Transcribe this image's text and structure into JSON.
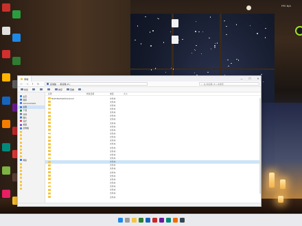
{
  "overlay": {
    "fps_text": "FPS N/A"
  },
  "desktop": {
    "left_icons": [
      {
        "label": "",
        "color": "#c9302c"
      },
      {
        "label": "",
        "color": "#2a9d3f"
      },
      {
        "label": "",
        "color": "#e0e0e0"
      },
      {
        "label": "",
        "color": "#1e88e5"
      },
      {
        "label": "",
        "color": "#d32f2f"
      },
      {
        "label": "",
        "color": "#2e7d32"
      },
      {
        "label": "",
        "color": "#ffb300"
      },
      {
        "label": "",
        "color": "#616161"
      },
      {
        "label": "",
        "color": "#1565c0"
      },
      {
        "label": "",
        "color": "#6a1b9a"
      },
      {
        "label": "",
        "color": "#f57c00"
      },
      {
        "label": "",
        "color": "#c62828"
      },
      {
        "label": "",
        "color": "#00897b"
      },
      {
        "label": "",
        "color": "#e53935"
      },
      {
        "label": "",
        "color": "#7cb342"
      },
      {
        "label": "",
        "color": "#5d4037"
      },
      {
        "label": "",
        "color": "#e91e63"
      },
      {
        "label": "",
        "color": "#fbc02d"
      }
    ],
    "file_icons": [
      {
        "label": "",
        "color": "#f2f2f2"
      },
      {
        "label": "",
        "color": "#f2f2f2"
      }
    ]
  },
  "explorer": {
    "tab_title": "本地",
    "window_controls": {
      "minimize": "—",
      "maximize": "☐",
      "close": "✕"
    },
    "address": {
      "parts": [
        "此电脑",
        "新加卷 (E:)"
      ],
      "search_placeholder": "在 新加卷 (E:) 中搜索"
    },
    "toolbar": [
      {
        "label": "新建"
      },
      {
        "label": ""
      },
      {
        "label": ""
      },
      {
        "label": ""
      },
      {
        "label": "排序"
      },
      {
        "label": "查看"
      },
      {
        "label": "···"
      }
    ],
    "nav_items": [
      {
        "label": "主页",
        "color": "#3d7bd9",
        "selected": false
      },
      {
        "label": "图库",
        "color": "#3d7bd9",
        "selected": false
      },
      {
        "label": "Administrator",
        "color": "#3d7bd9",
        "selected": false
      },
      {
        "label": "桌面",
        "color": "#3d7bd9",
        "selected": true
      },
      {
        "label": "下载",
        "color": "#2a8f4b",
        "selected": false
      },
      {
        "label": "文档",
        "color": "#6b7fa8",
        "selected": false
      },
      {
        "label": "图片",
        "color": "#3d7bd9",
        "selected": false
      },
      {
        "label": "音乐",
        "color": "#d9534f",
        "selected": false
      },
      {
        "label": "视频",
        "color": "#8a4fd9",
        "selected": false
      },
      {
        "label": "此电脑",
        "color": "#3d7bd9",
        "selected": false
      },
      {
        "label": "",
        "color": "#f5c542",
        "selected": false
      },
      {
        "label": "",
        "color": "#f5c542",
        "selected": false
      },
      {
        "label": "",
        "color": "#f5c542",
        "selected": false
      },
      {
        "label": "",
        "color": "#f5c542",
        "selected": false
      },
      {
        "label": "",
        "color": "#f5c542",
        "selected": false
      },
      {
        "label": "",
        "color": "#f5c542",
        "selected": false
      },
      {
        "label": "",
        "color": "#f5c542",
        "selected": false
      },
      {
        "label": "",
        "color": "#f5c542",
        "selected": false
      },
      {
        "label": "网络",
        "color": "#3d7bd9",
        "selected": false
      },
      {
        "label": "",
        "color": "#f5c542",
        "selected": false
      },
      {
        "label": "",
        "color": "#f5c542",
        "selected": false
      },
      {
        "label": "",
        "color": "#f5c542",
        "selected": false
      },
      {
        "label": "",
        "color": "#f5c542",
        "selected": false
      },
      {
        "label": "",
        "color": "#f5c542",
        "selected": false
      },
      {
        "label": "",
        "color": "#f5c542",
        "selected": false
      },
      {
        "label": "",
        "color": "#f5c542",
        "selected": false
      },
      {
        "label": "",
        "color": "#f5c542",
        "selected": false
      }
    ],
    "columns": [
      "名称",
      "修改日期",
      "类型",
      "大小"
    ],
    "files": [
      {
        "name": "BaiduNetdiskDownload",
        "date": "",
        "type": "文件夹",
        "selected": false
      },
      {
        "name": "",
        "date": "",
        "type": "文件夹",
        "selected": false
      },
      {
        "name": "",
        "date": "",
        "type": "文件夹",
        "selected": false
      },
      {
        "name": "",
        "date": "",
        "type": "文件夹",
        "selected": false
      },
      {
        "name": "",
        "date": "",
        "type": "文件夹",
        "selected": false
      },
      {
        "name": "",
        "date": "",
        "type": "文件夹",
        "selected": false
      },
      {
        "name": "",
        "date": "",
        "type": "文件夹",
        "selected": false
      },
      {
        "name": "",
        "date": "",
        "type": "文件夹",
        "selected": false
      },
      {
        "name": "",
        "date": "",
        "type": "文件夹",
        "selected": false
      },
      {
        "name": "",
        "date": "",
        "type": "文件夹",
        "selected": false
      },
      {
        "name": "",
        "date": "",
        "type": "文件夹",
        "selected": false
      },
      {
        "name": "",
        "date": "",
        "type": "文件夹",
        "selected": false
      },
      {
        "name": "",
        "date": "",
        "type": "文件夹",
        "selected": false
      },
      {
        "name": "",
        "date": "",
        "type": "文件夹",
        "selected": false
      },
      {
        "name": "",
        "date": "",
        "type": "文件夹",
        "selected": false
      },
      {
        "name": "",
        "date": "",
        "type": "文件夹",
        "selected": false
      },
      {
        "name": "",
        "date": "",
        "type": "文件夹",
        "selected": false
      },
      {
        "name": "",
        "date": "",
        "type": "文件夹",
        "selected": false
      },
      {
        "name": "",
        "date": "",
        "type": "文件夹",
        "selected": true
      },
      {
        "name": "",
        "date": "",
        "type": "文件夹",
        "selected": false
      },
      {
        "name": "",
        "date": "",
        "type": "文件夹",
        "selected": false
      },
      {
        "name": "",
        "date": "",
        "type": "文件夹",
        "selected": false
      },
      {
        "name": "",
        "date": "",
        "type": "文件夹",
        "selected": false
      },
      {
        "name": "",
        "date": "",
        "type": "文件夹",
        "selected": false
      },
      {
        "name": "",
        "date": "",
        "type": "文件夹",
        "selected": false
      },
      {
        "name": "",
        "date": "",
        "type": "文件夹",
        "selected": false
      },
      {
        "name": "",
        "date": "",
        "type": "文件夹",
        "selected": false
      },
      {
        "name": "",
        "date": "",
        "type": "文件夹",
        "selected": false
      },
      {
        "name": "",
        "date": "",
        "type": "文件夹",
        "selected": false
      }
    ]
  },
  "taskbar": {
    "icons": [
      {
        "name": "start-icon",
        "color": "#1e88e5"
      },
      {
        "name": "search-icon",
        "color": "#9e9e9e"
      },
      {
        "name": "app-icon",
        "color": "#f5c542"
      },
      {
        "name": "app-icon",
        "color": "#2e7d32"
      },
      {
        "name": "app-icon",
        "color": "#1565c0"
      },
      {
        "name": "app-icon",
        "color": "#c62828"
      },
      {
        "name": "app-icon",
        "color": "#6a1b9a"
      },
      {
        "name": "app-icon",
        "color": "#00897b"
      },
      {
        "name": "app-icon",
        "color": "#ef6c00"
      },
      {
        "name": "app-icon",
        "color": "#37474f"
      }
    ],
    "tray_text": ""
  }
}
